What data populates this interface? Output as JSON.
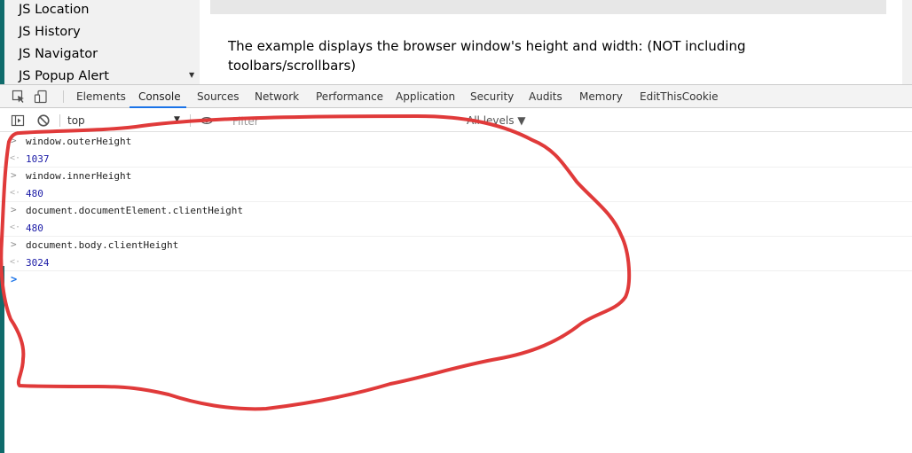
{
  "sidenav": {
    "items": [
      {
        "label": "JS Location"
      },
      {
        "label": "JS History"
      },
      {
        "label": "JS Navigator"
      },
      {
        "label": "JS Popup Alert"
      }
    ]
  },
  "page": {
    "text": "The example displays the browser window's height and width: (NOT including toolbars/scrollbars)"
  },
  "devtools": {
    "tabs": [
      {
        "label": "Elements"
      },
      {
        "label": "Console"
      },
      {
        "label": "Sources"
      },
      {
        "label": "Network"
      },
      {
        "label": "Performance"
      },
      {
        "label": "Application"
      },
      {
        "label": "Security"
      },
      {
        "label": "Audits"
      },
      {
        "label": "Memory"
      },
      {
        "label": "EditThisCookie"
      }
    ],
    "active_tab": "Console",
    "context": "top",
    "filter_placeholder": "Filter",
    "levels": "All levels ▼"
  },
  "console": {
    "entries": [
      {
        "input": "window.outerHeight",
        "output": "1037"
      },
      {
        "input": "window.innerHeight",
        "output": "480"
      },
      {
        "input": "document.documentElement.clientHeight",
        "output": "480"
      },
      {
        "input": "document.body.clientHeight",
        "output": "3024"
      }
    ]
  },
  "colors": {
    "accent": "#1a73e8",
    "annotation": "#e03a3a",
    "number": "#1a1aa6"
  }
}
